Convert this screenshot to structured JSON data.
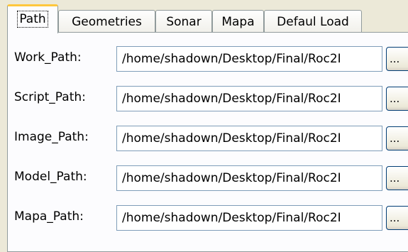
{
  "tabs": [
    {
      "label": "Path",
      "active": true
    },
    {
      "label": "Geometries",
      "active": false
    },
    {
      "label": "Sonar",
      "active": false
    },
    {
      "label": "Mapa",
      "active": false
    },
    {
      "label": "Defaul Load",
      "active": false
    }
  ],
  "paths": [
    {
      "label": "Work_Path:",
      "value": "/home/shadown/Desktop/Final/Roc2I",
      "browse_label": "..."
    },
    {
      "label": "Script_Path:",
      "value": "/home/shadown/Desktop/Final/Roc2I",
      "browse_label": "..."
    },
    {
      "label": "Image_Path:",
      "value": "/home/shadown/Desktop/Final/Roc2I",
      "browse_label": "..."
    },
    {
      "label": "Model_Path:",
      "value": "/home/shadown/Desktop/Final/Roc2I",
      "browse_label": "..."
    },
    {
      "label": "Mapa_Path:",
      "value": "/home/shadown/Desktop/Final/Roc2I",
      "browse_label": "..."
    }
  ],
  "colors": {
    "window_bg": "#ece9d8",
    "panel_bg": "#fcfcfe",
    "tab_highlight": "#ffc73c",
    "field_border": "#7f9db9",
    "button_border": "#003c74"
  }
}
